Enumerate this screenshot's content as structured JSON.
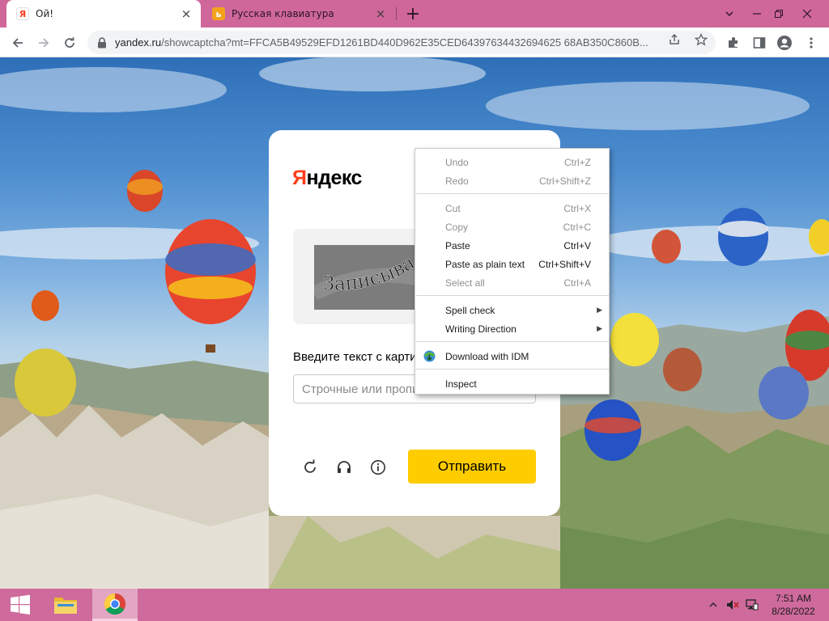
{
  "tabs": [
    {
      "title": "Ой!",
      "favicon": "yandex-favicon",
      "active": true
    },
    {
      "title": "Русская клавиатура",
      "favicon": "keyboard-site-favicon",
      "active": false
    }
  ],
  "address_bar": {
    "host": "yandex.ru",
    "path": "/showcaptcha?mt=FFCA5B49529EFD1261BD440D962E35CED64397634432694625 68AB350C860B..."
  },
  "captcha": {
    "logo_first": "Я",
    "logo_rest": "ндекс",
    "captcha_word": "Записыва",
    "prompt": "Введите текст с картинки",
    "input_placeholder": "Строчные или прописные",
    "submit_label": "Отправить"
  },
  "context_menu": {
    "items": [
      {
        "label": "Undo",
        "shortcut": "Ctrl+Z",
        "disabled": true
      },
      {
        "label": "Redo",
        "shortcut": "Ctrl+Shift+Z",
        "disabled": true
      },
      {
        "label": "Cut",
        "shortcut": "Ctrl+X",
        "disabled": true
      },
      {
        "label": "Copy",
        "shortcut": "Ctrl+C",
        "disabled": true
      },
      {
        "label": "Paste",
        "shortcut": "Ctrl+V",
        "disabled": false
      },
      {
        "label": "Paste as plain text",
        "shortcut": "Ctrl+Shift+V",
        "disabled": false
      },
      {
        "label": "Select all",
        "shortcut": "Ctrl+A",
        "disabled": true
      },
      {
        "label": "Spell check",
        "shortcut": "",
        "disabled": false,
        "submenu": true
      },
      {
        "label": "Writing Direction",
        "shortcut": "",
        "disabled": false,
        "submenu": true
      },
      {
        "label": "Download with IDM",
        "shortcut": "",
        "disabled": false,
        "icon": "idm-icon"
      },
      {
        "label": "Inspect",
        "shortcut": "",
        "disabled": false
      }
    ]
  },
  "taskbar": {
    "time": "7:51 AM",
    "date": "8/28/2022"
  },
  "colors": {
    "tab_strip": "#d0679b",
    "taskbar": "#ce6a9c",
    "yandex_red": "#fc3f1d",
    "submit_yellow": "#ffcc00"
  }
}
